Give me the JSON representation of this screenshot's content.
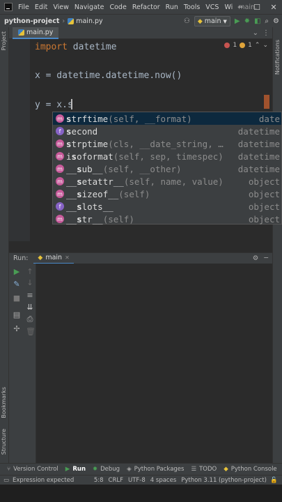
{
  "window": {
    "menu": [
      "File",
      "Edit",
      "View",
      "Navigate",
      "Code",
      "Refactor",
      "Run",
      "Tools",
      "VCS",
      "Wi",
      "main."
    ],
    "minimize": "─",
    "maximize": "☐",
    "close": "✕"
  },
  "navbar": {
    "project": "python-project",
    "file": "main.py",
    "run_config": "main"
  },
  "left_strip": {
    "project": "Project",
    "bookmarks": "Bookmarks",
    "structure": "Structure"
  },
  "right_strip": {
    "notifications": "Notifications"
  },
  "tabs": [
    {
      "label": "main.py",
      "active": true
    }
  ],
  "editor": {
    "inspections": {
      "errors": "1",
      "warnings": "1"
    },
    "lines": [
      {
        "kw": "import",
        "text": " datetime"
      },
      {
        "kw": "",
        "text": "x = datetime.datetime.now()"
      },
      {
        "kw": "",
        "text": "y = x.s"
      }
    ]
  },
  "completion": [
    {
      "match": "s",
      "rest": "trftime",
      "sig": "(self, __format)",
      "type": "date",
      "kind": "m",
      "selected": true
    },
    {
      "match": "s",
      "rest": "econd",
      "sig": "",
      "type": "datetime",
      "kind": "f",
      "selected": false
    },
    {
      "match": "s",
      "rest": "trptime",
      "sig": "(cls, __date_string, …",
      "type": "datetime",
      "kind": "m",
      "selected": false
    },
    {
      "match": "",
      "rest": "i",
      "match2": "s",
      "rest2": "oformat",
      "sig": "(self, sep, timespec)",
      "type": "datetime",
      "kind": "m",
      "selected": false
    },
    {
      "match": "",
      "rest": "__",
      "match2": "s",
      "rest2": "ub__",
      "sig": "(self, __other)",
      "type": "datetime",
      "kind": "m",
      "selected": false
    },
    {
      "match": "",
      "rest": "__",
      "match2": "s",
      "rest2": "etattr__",
      "sig": "(self, name, value)",
      "type": "object",
      "kind": "m",
      "selected": false
    },
    {
      "match": "",
      "rest": "__",
      "match2": "s",
      "rest2": "izeof__",
      "sig": "(self)",
      "type": "object",
      "kind": "m",
      "selected": false
    },
    {
      "match": "",
      "rest": "__",
      "match2": "s",
      "rest2": "lots__",
      "sig": "",
      "type": "object",
      "kind": "f",
      "selected": false
    },
    {
      "match": "",
      "rest": "__",
      "match2": "s",
      "rest2": "tr__",
      "sig": "(self)",
      "type": "object",
      "kind": "m",
      "selected": false
    }
  ],
  "run_panel": {
    "title": "Run:",
    "tab": "main"
  },
  "bottom_tabs": [
    {
      "label": "Version Control",
      "icon": "branch-icon"
    },
    {
      "label": "Run",
      "icon": "play-icon",
      "active": true
    },
    {
      "label": "Debug",
      "icon": "bug-icon"
    },
    {
      "label": "Python Packages",
      "icon": "layers-icon"
    },
    {
      "label": "TODO",
      "icon": "list-icon"
    },
    {
      "label": "Python Console",
      "icon": "python-icon"
    }
  ],
  "status": {
    "message": "Expression expected",
    "position": "5:8",
    "line_sep": "CRLF",
    "encoding": "UTF-8",
    "indent": "4 spaces",
    "interpreter": "Python 3.11 (python-project)"
  },
  "colors": {
    "keyword": "#cc7832",
    "accent": "#4a88c7",
    "error": "#c75450",
    "run_green": "#499c54"
  }
}
